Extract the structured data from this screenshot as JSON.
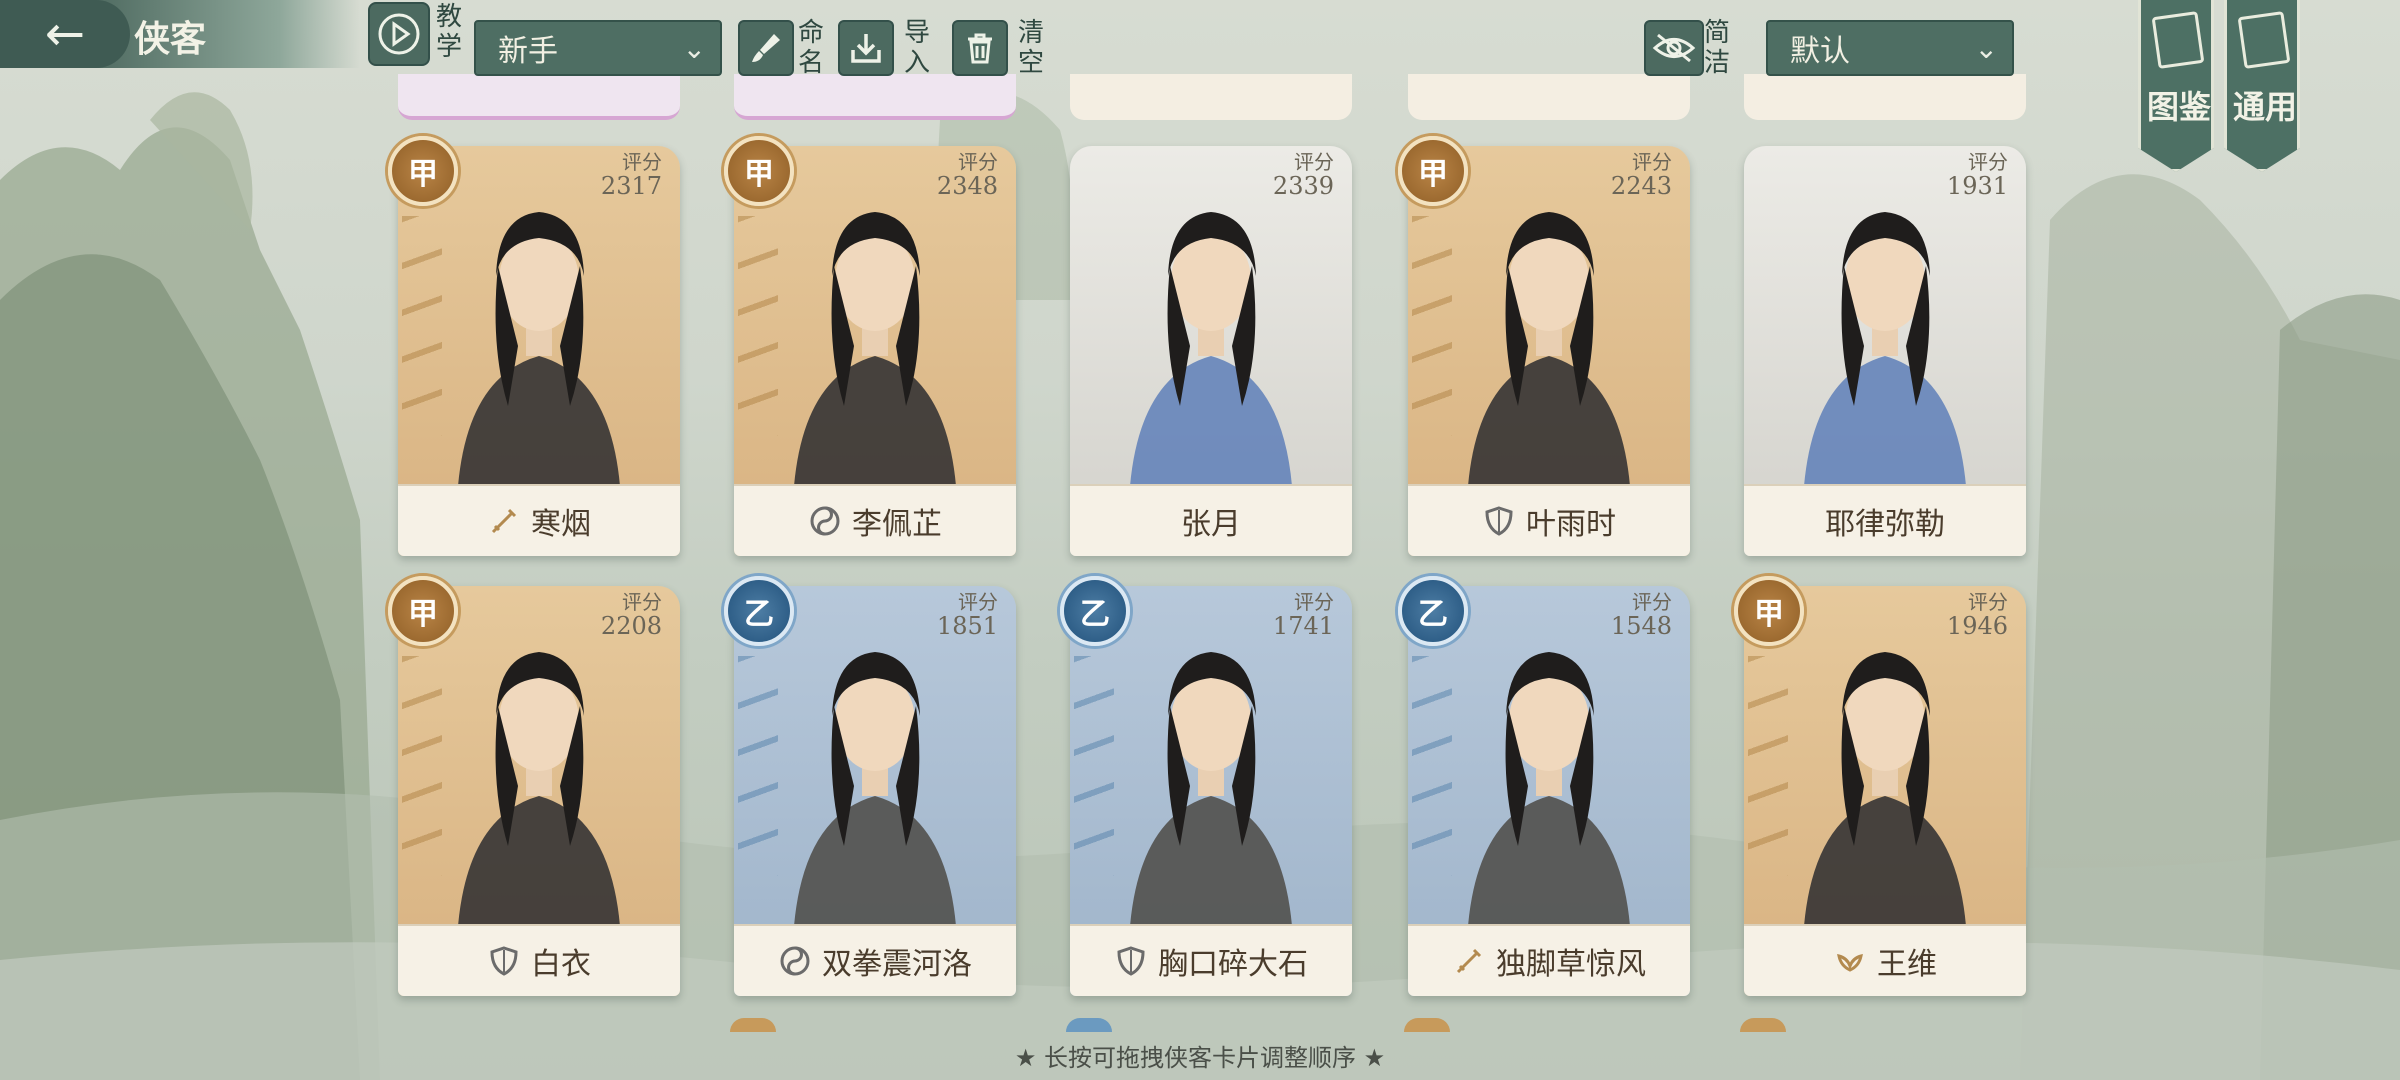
{
  "header": {
    "title": "侠客",
    "tutorial_label": "教学",
    "filter_select": {
      "value": "新手"
    },
    "rename_label": "命名",
    "import_label": "导入",
    "clear_label": "清空",
    "simple_label": "简洁",
    "sort_select": {
      "value": "默认"
    },
    "catalog_label": "图鉴",
    "general_label": "通用"
  },
  "score_label": "评分",
  "cards": [
    {
      "name": "寒烟",
      "grade": "甲",
      "score": "2317",
      "tier": "gold",
      "class_icon": "sword-icon"
    },
    {
      "name": "李佩芷",
      "grade": "甲",
      "score": "2348",
      "tier": "gold",
      "class_icon": "taiji-icon"
    },
    {
      "name": "张月",
      "grade": "",
      "score": "2339",
      "tier": "gray",
      "class_icon": ""
    },
    {
      "name": "叶雨时",
      "grade": "甲",
      "score": "2243",
      "tier": "gold",
      "class_icon": "shield-icon"
    },
    {
      "name": "耶律弥勒",
      "grade": "",
      "score": "1931",
      "tier": "gray",
      "class_icon": ""
    },
    {
      "name": "白衣",
      "grade": "甲",
      "score": "2208",
      "tier": "gold",
      "class_icon": "shield-icon"
    },
    {
      "name": "双拳震河洛",
      "grade": "乙",
      "score": "1851",
      "tier": "blue",
      "class_icon": "taiji-icon"
    },
    {
      "name": "胸口碎大石",
      "grade": "乙",
      "score": "1741",
      "tier": "blue",
      "class_icon": "shield-icon"
    },
    {
      "name": "独脚草惊风",
      "grade": "乙",
      "score": "1548",
      "tier": "blue",
      "class_icon": "sword-icon"
    },
    {
      "name": "王维",
      "grade": "甲",
      "score": "1946",
      "tier": "gold",
      "class_icon": "lotus-icon"
    }
  ],
  "footer_hint": "★ 长按可拖拽侠客卡片调整顺序 ★",
  "colors": {
    "gold_tier": "#d8b281",
    "blue_tier": "#9fb4ca",
    "gray_tier": "#d2d1cb",
    "ui_green": "#4e6e63"
  }
}
